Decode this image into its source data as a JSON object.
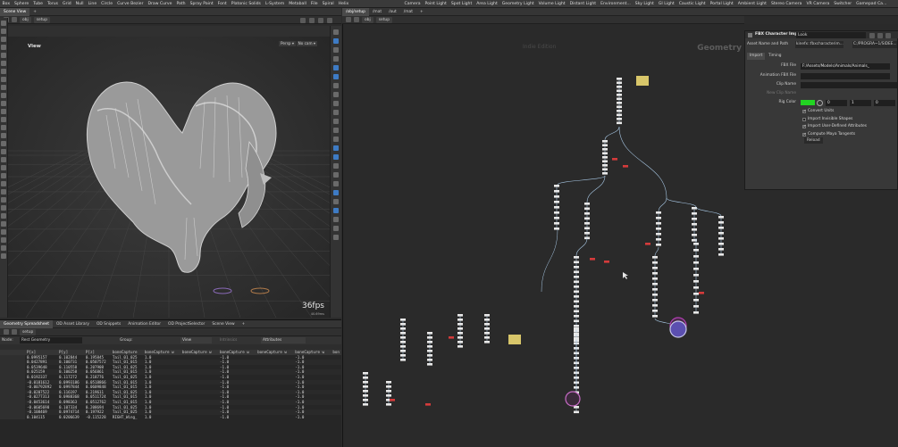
{
  "menubar": {
    "left_items": [
      "Box",
      "Sphere",
      "Tube",
      "Torus",
      "Grid",
      "Null",
      "Line",
      "Circle",
      "Curve Bezier",
      "Draw Curve",
      "Path",
      "Spray Paint",
      "Font",
      "Platonic Solids",
      "L-System",
      "Metaball",
      "File",
      "Spiral",
      "Helix"
    ],
    "right_items": [
      "Camera",
      "Point Light",
      "Spot Light",
      "Area Light",
      "Geometry Light",
      "Volume Light",
      "Distant Light",
      "Environment...",
      "Sky Light",
      "GI Light",
      "Caustic Light",
      "Portal Light",
      "Ambient Light",
      "Stereo Camera",
      "VR Camera",
      "Switcher",
      "Gamepad Ca..."
    ]
  },
  "left_tabs": {
    "items": [
      "Scene View"
    ],
    "add": "+"
  },
  "left_path": {
    "obj": "obj",
    "node": "setup"
  },
  "viewport": {
    "label": "View",
    "persp": "Persp ▾",
    "nocam": "No cam ▾",
    "fps": "36fps",
    "fps_sub": "40.69ms"
  },
  "network_tabs": {
    "items": [
      "/obj/setup",
      "/mat",
      "/out",
      "/mat"
    ],
    "add": "+"
  },
  "network_path": {
    "obj": "obj",
    "node": "setup"
  },
  "network": {
    "watermark": "Indie Edition",
    "context": "Geometry"
  },
  "params": {
    "title": "FBX Character Import",
    "node_name": "Look",
    "asset_label": "Asset Name and Path",
    "asset_name": "kinefx::fbxcharacterim...",
    "asset_path": "C:/PROGRA~1/SIDEE...",
    "tabs": [
      "Import",
      "Timing"
    ],
    "fbx_file_label": "FBX File",
    "fbx_file_value": "F:/Assets/Models/Animals/Animals_",
    "anim_fbx_label": "Animation FBX File",
    "clip_name_label": "Clip Name",
    "new_clip_label": "New Clip Name",
    "rig_color_label": "Rig Color",
    "rig_color": "#22d422",
    "rig_color_values": [
      "0",
      "1",
      "0"
    ],
    "checks": [
      {
        "label": "Convert Units",
        "on": true
      },
      {
        "label": "Import Invisible Shapes",
        "on": false
      },
      {
        "label": "Import User-Defined Attributes",
        "on": true
      },
      {
        "label": "Compute Maya Tangents",
        "on": true
      }
    ],
    "reload": "Reload"
  },
  "spreadsheet": {
    "tabs": [
      "Geometry Spreadsheet",
      "OD Asset Library",
      "OD Snippets",
      "Animation Editor",
      "OD ProjectSelector",
      "Scene View"
    ],
    "path_node": "setup",
    "node_label": "Node: ",
    "node_value": "Rest Geometry",
    "group_label": "Group:",
    "view_label": "View",
    "intrinsics_label": "Intrinsics",
    "attributes_label": "Attributes",
    "columns": [
      "P[x]",
      "P[y]",
      "P[z]",
      "boneCapture",
      "boneCapture w",
      "boneCapture w",
      "boneCapture w",
      "boneCapture w",
      "boneCapture w",
      "bon"
    ],
    "rows": [
      [
        "0.0995157",
        "0.102844",
        "0.195845",
        "Tail_01_025",
        "1.0",
        "",
        "-1.0",
        "",
        "-1.0",
        ""
      ],
      [
        "0.0427891",
        "0.100731",
        "0.0507572",
        "Tail_01_015",
        "1.0",
        "",
        "-1.0",
        "",
        "-1.0",
        ""
      ],
      [
        "0.0539648",
        "0.110558",
        "0.207908",
        "Tail_01_025",
        "1.0",
        "",
        "-1.0",
        "",
        "-1.0",
        ""
      ],
      [
        "0.025159",
        "0.100258",
        "0.056861",
        "Tail_01_015",
        "1.0",
        "",
        "-1.0",
        "",
        "-1.0",
        ""
      ],
      [
        "0.0192337",
        "0.117272",
        "0.218776",
        "Tail_01_025",
        "1.0",
        "",
        "-1.0",
        "",
        "-1.0",
        ""
      ],
      [
        "-0.0181612",
        "0.0993186",
        "0.0518866",
        "Tail_01_015",
        "1.0",
        "",
        "-1.0",
        "",
        "-1.0",
        ""
      ],
      [
        "-0.00792892",
        "0.0997844",
        "0.0609848",
        "Tail_01_015",
        "1.0",
        "",
        "-1.0",
        "",
        "-1.0",
        ""
      ],
      [
        "-0.0207522",
        "0.116197",
        "0.219611",
        "Tail_01_025",
        "1.0",
        "",
        "-1.0",
        "",
        "-1.0",
        ""
      ],
      [
        "-0.0277313",
        "0.0988368",
        "0.0511724",
        "Tail_01_015",
        "1.0",
        "",
        "-1.0",
        "",
        "-1.0",
        ""
      ],
      [
        "-0.0453614",
        "0.098363",
        "0.0512762",
        "Tail_01_015",
        "1.0",
        "",
        "-1.0",
        "",
        "-1.0",
        ""
      ],
      [
        "-0.0605698",
        "0.107334",
        "0.208694",
        "Tail_01_025",
        "1.0",
        "",
        "-1.0",
        "",
        "-1.0",
        ""
      ],
      [
        "-0.108469",
        "0.0974714",
        "0.197922",
        "Tail_01_025",
        "1.0",
        "",
        "-1.0",
        "",
        "-1.0",
        ""
      ],
      [
        "0.104115",
        "0.0206639",
        "-0.115228",
        "RIGHT_Wing_",
        "1.0",
        "",
        "-1.0",
        "",
        "-1.0",
        ""
      ]
    ]
  },
  "colors": {
    "accent_blue": "#3e7bc4",
    "node_body": "#e8e8e8",
    "wire": "#a9c9e6",
    "error_red": "#d43b3b",
    "sticky": "#d8c66a"
  }
}
